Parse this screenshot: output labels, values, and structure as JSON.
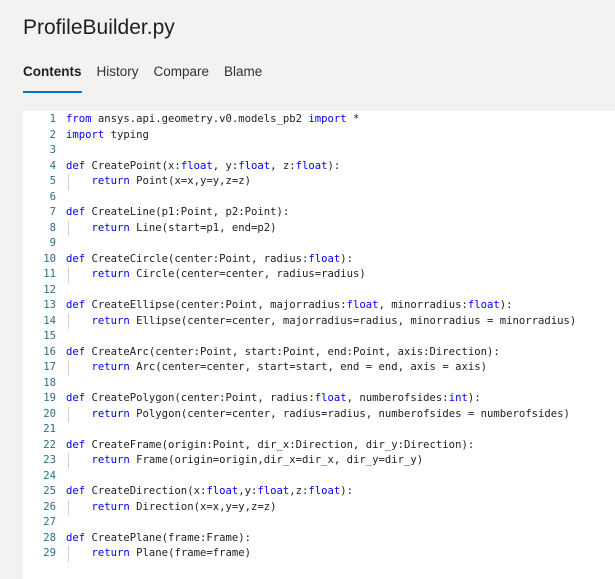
{
  "file": {
    "title": "ProfileBuilder.py"
  },
  "tabs": [
    {
      "label": "Contents",
      "active": true
    },
    {
      "label": "History",
      "active": false
    },
    {
      "label": "Compare",
      "active": false
    },
    {
      "label": "Blame",
      "active": false
    }
  ],
  "colors": {
    "accent": "#0078d4",
    "keyword": "#0000ff",
    "line_number": "#2b6e8a"
  },
  "code": {
    "lines": [
      {
        "n": "1",
        "text": "from ansys.api.geometry.v0.models_pb2 import *"
      },
      {
        "n": "2",
        "text": "import typing"
      },
      {
        "n": "3",
        "text": ""
      },
      {
        "n": "4",
        "text": "def CreatePoint(x:float, y:float, z:float):"
      },
      {
        "n": "5",
        "text": "    return Point(x=x,y=y,z=z)"
      },
      {
        "n": "6",
        "text": ""
      },
      {
        "n": "7",
        "text": "def CreateLine(p1:Point, p2:Point):"
      },
      {
        "n": "8",
        "text": "    return Line(start=p1, end=p2)"
      },
      {
        "n": "9",
        "text": ""
      },
      {
        "n": "10",
        "text": "def CreateCircle(center:Point, radius:float):"
      },
      {
        "n": "11",
        "text": "    return Circle(center=center, radius=radius)"
      },
      {
        "n": "12",
        "text": ""
      },
      {
        "n": "13",
        "text": "def CreateEllipse(center:Point, majorradius:float, minorradius:float):"
      },
      {
        "n": "14",
        "text": "    return Ellipse(center=center, majorradius=radius, minorradius = minorradius)"
      },
      {
        "n": "15",
        "text": ""
      },
      {
        "n": "16",
        "text": "def CreateArc(center:Point, start:Point, end:Point, axis:Direction):"
      },
      {
        "n": "17",
        "text": "    return Arc(center=center, start=start, end = end, axis = axis)"
      },
      {
        "n": "18",
        "text": ""
      },
      {
        "n": "19",
        "text": "def CreatePolygon(center:Point, radius:float, numberofsides:int):"
      },
      {
        "n": "20",
        "text": "    return Polygon(center=center, radius=radius, numberofsides = numberofsides)"
      },
      {
        "n": "21",
        "text": ""
      },
      {
        "n": "22",
        "text": "def CreateFrame(origin:Point, dir_x:Direction, dir_y:Direction):"
      },
      {
        "n": "23",
        "text": "    return Frame(origin=origin,dir_x=dir_x, dir_y=dir_y)"
      },
      {
        "n": "24",
        "text": ""
      },
      {
        "n": "25",
        "text": "def CreateDirection(x:float,y:float,z:float):"
      },
      {
        "n": "26",
        "text": "    return Direction(x=x,y=y,z=z)"
      },
      {
        "n": "27",
        "text": ""
      },
      {
        "n": "28",
        "text": "def CreatePlane(frame:Frame):"
      },
      {
        "n": "29",
        "text": "    return Plane(frame=frame)"
      }
    ]
  }
}
